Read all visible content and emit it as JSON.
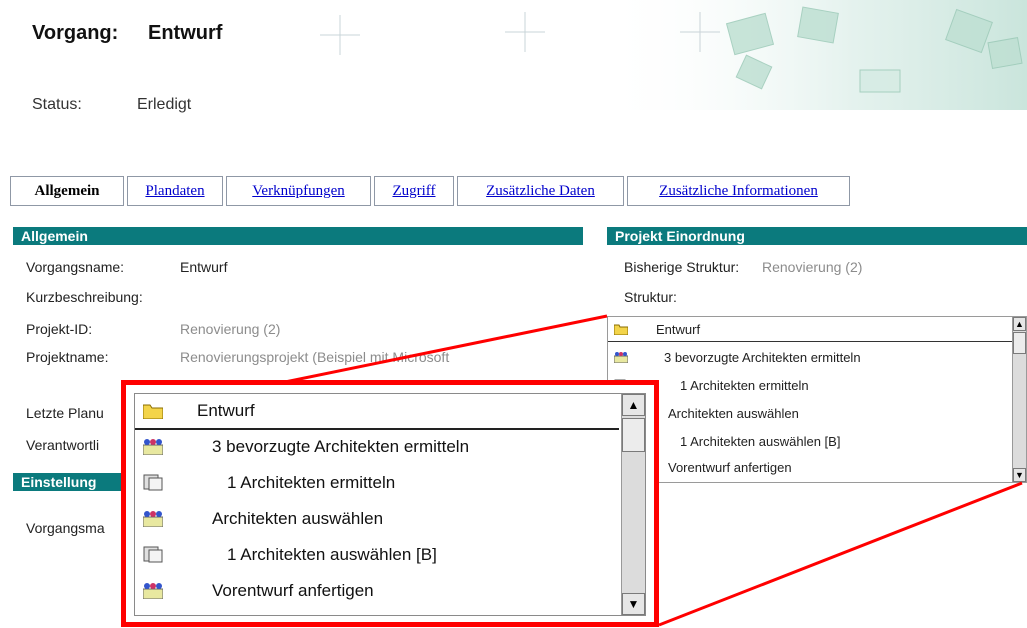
{
  "header": {
    "title_label": "Vorgang:",
    "title_value": "Entwurf",
    "status_label": "Status:",
    "status_value": "Erledigt"
  },
  "tabs": [
    {
      "label": "Allgemein",
      "active": true
    },
    {
      "label": "Plandaten",
      "active": false
    },
    {
      "label": "Verknüpfungen",
      "active": false
    },
    {
      "label": "Zugriff",
      "active": false
    },
    {
      "label": "Zusätzliche Daten",
      "active": false
    },
    {
      "label": "Zusätzliche Informationen",
      "active": false
    }
  ],
  "general": {
    "section_title": "Allgemein",
    "vorgangsname_label": "Vorgangsname:",
    "vorgangsname_value": "Entwurf",
    "kurzbeschreibung_label": "Kurzbeschreibung:",
    "projekt_id_label": "Projekt-ID:",
    "projekt_id_value": "Renovierung (2)",
    "projektname_label": "Projektname:",
    "projektname_value": "Renovierungsprojekt (Beispiel mit Microsoft",
    "letzte_plan_label": "Letzte Planu",
    "verantwortlich_label": "Verantwortli",
    "settings_title": "Einstellung",
    "vorgangsma_label": "Vorgangsma"
  },
  "project": {
    "section_title": "Projekt Einordnung",
    "bisherige_label": "Bisherige Struktur:",
    "bisherige_value": "Renovierung (2)",
    "struktur_label": "Struktur:"
  },
  "tree_small": [
    {
      "text": "Entwurf",
      "icon": "folder-icon"
    },
    {
      "text": "3 bevorzugte Architekten ermitteln",
      "icon": "resource-group-icon"
    },
    {
      "text": "1 Architekten ermitteln",
      "icon": "task-icon"
    },
    {
      "text": "Architekten auswählen",
      "icon": "resource-group-icon"
    },
    {
      "text": "1 Architekten auswählen [B]",
      "icon": "task-icon"
    },
    {
      "text": "Vorentwurf anfertigen",
      "icon": "resource-group-icon"
    }
  ],
  "tree_zoom": [
    {
      "text": "Entwurf",
      "icon": "folder-icon"
    },
    {
      "text": "3 bevorzugte Architekten ermitteln",
      "icon": "resource-group-icon"
    },
    {
      "text": "1 Architekten ermitteln",
      "icon": "task-icon"
    },
    {
      "text": "Architekten auswählen",
      "icon": "resource-group-icon"
    },
    {
      "text": "1 Architekten auswählen [B]",
      "icon": "task-icon"
    },
    {
      "text": "Vorentwurf anfertigen",
      "icon": "resource-group-icon"
    }
  ],
  "colors": {
    "section_header": "#0b7a7d",
    "link": "#0000cc",
    "highlight": "#ff0000"
  }
}
